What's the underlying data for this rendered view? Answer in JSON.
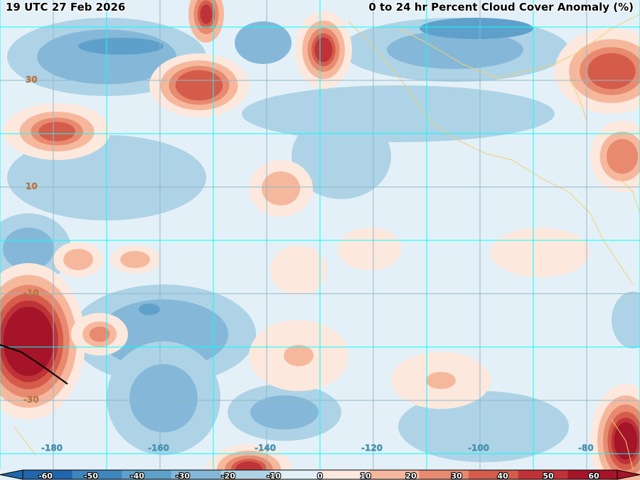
{
  "header": {
    "valid_time": "19 UTC 27 Feb 2026",
    "product_title": "0 to 24 hr Percent Cloud Cover Anomaly (%)"
  },
  "map": {
    "latitude_labels": [
      "30",
      "10",
      "-10",
      "-30"
    ],
    "longitude_labels": [
      "-180",
      "-160",
      "-140",
      "-120",
      "-100",
      "-80"
    ]
  },
  "colorbar": {
    "ticks": [
      "-60",
      "-50",
      "-40",
      "-30",
      "-20",
      "-10",
      "0",
      "10",
      "20",
      "30",
      "40",
      "50",
      "60"
    ],
    "colors": [
      "#2166ac",
      "#3f86bd",
      "#5fa0cb",
      "#85b8d8",
      "#aed3e6",
      "#e1eff6",
      "#fde8de",
      "#f6b89d",
      "#e88a6f",
      "#d55c4b",
      "#bf3338",
      "#a51428"
    ]
  }
}
